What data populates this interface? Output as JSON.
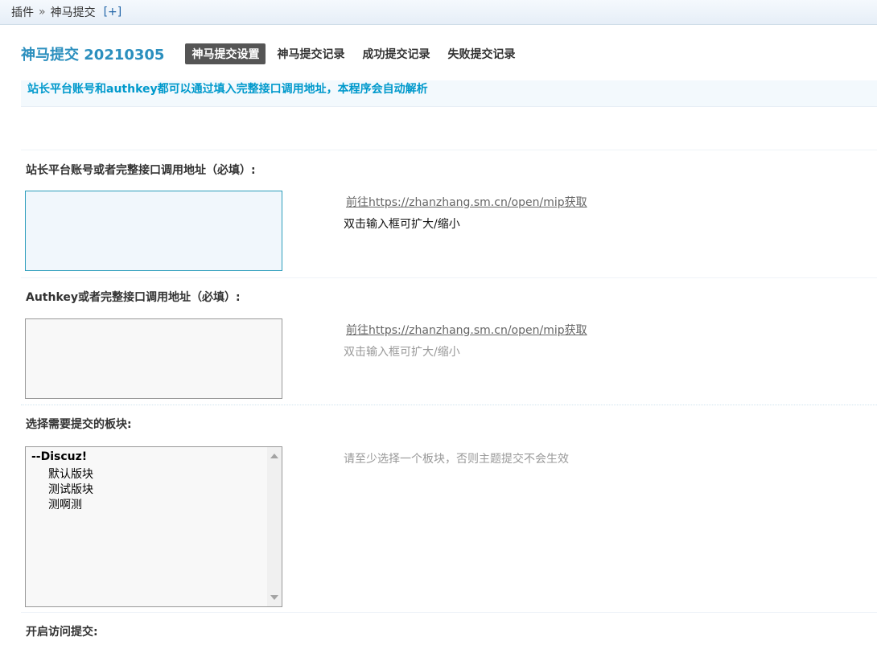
{
  "breadcrumb": {
    "plugins": "插件",
    "separator": "»",
    "current": "神马提交",
    "add": "[+]"
  },
  "header": {
    "title": "神马提交 20210305",
    "tabs": [
      {
        "label": "神马提交设置",
        "active": true
      },
      {
        "label": "神马提交记录"
      },
      {
        "label": "成功提交记录"
      },
      {
        "label": "失败提交记录"
      }
    ]
  },
  "tip": "站长平台账号和authkey都可以通过填入完整接口调用地址，本程序会自动解析",
  "form": {
    "account": {
      "label": "站长平台账号或者完整接口调用地址（必填）:",
      "value": "",
      "link": "前往https://zhanzhang.sm.cn/open/mip获取",
      "note": "双击输入框可扩大/缩小"
    },
    "authkey": {
      "label": "Authkey或者完整接口调用地址（必填）:",
      "value": "",
      "link": "前往https://zhanzhang.sm.cn/open/mip获取",
      "note": "双击输入框可扩大/缩小"
    },
    "forums": {
      "label": "选择需要提交的板块:",
      "group": "--Discuz!",
      "options": [
        "默认版块",
        "测试版块",
        "测啊测"
      ],
      "note": "请至少选择一个板块，否则主题提交不会生效"
    },
    "visit_submit": {
      "label": "开启访问提交:"
    }
  },
  "colors": {
    "accent": "#2b8fbe",
    "tip": "#0099cc",
    "active_tab": "#555555"
  }
}
